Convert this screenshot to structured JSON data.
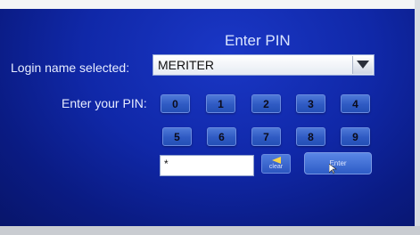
{
  "dialog": {
    "title": "Enter PIN"
  },
  "login": {
    "label": "Login name selected:",
    "value": "MERITER"
  },
  "pin": {
    "label": "Enter your PIN:",
    "keys_row1": [
      "0",
      "1",
      "2",
      "3",
      "4"
    ],
    "keys_row2": [
      "5",
      "6",
      "7",
      "8",
      "9"
    ],
    "field_value": "*"
  },
  "buttons": {
    "clear_label": "clear",
    "enter_label": "Enter"
  },
  "icons": {
    "dropdown": "chevron-down-icon",
    "clear": "backspace-arrow-icon",
    "pointer": "mouse-pointer-icon"
  }
}
